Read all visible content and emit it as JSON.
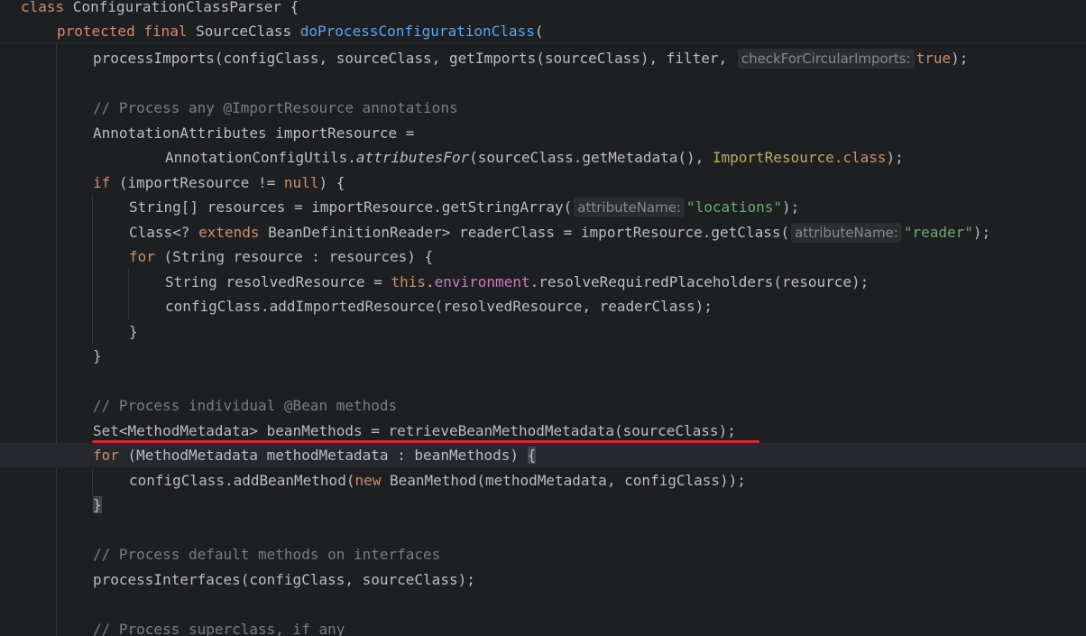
{
  "editor": {
    "lines": {
      "l0": {
        "kw": "class",
        "rest": " ConfigurationClassParser {"
      },
      "l1": {
        "kw1": "protected",
        "kw2": "final",
        "type": "SourceClass",
        "method": "doProcessConfigurationClass",
        "paren": "("
      },
      "l2": {
        "pre": "processImports(configClass, sourceClass, getImports(sourceClass), filter, ",
        "hint": "checkForCircularImports:",
        "val": "true",
        "post": ");"
      },
      "l3": {
        "comment": "// Process any @ImportResource annotations"
      },
      "l4": {
        "text": "AnnotationAttributes importResource ="
      },
      "l5": {
        "pre": "AnnotationConfigUtils.",
        "ital": "attributesFor",
        "mid": "(sourceClass.getMetadata(), ",
        "ann": "ImportResource",
        "dot": ".",
        "kw": "class",
        "post": ");"
      },
      "l6": {
        "kw": "if",
        "mid": " (importResource != ",
        "null": "null",
        "post": ") {"
      },
      "l7": {
        "pre": "String[] resources = importResource.getStringArray(",
        "hint": "attributeName:",
        "str": "\"locations\"",
        "post": ");"
      },
      "l8": {
        "pre": "Class<? ",
        "kw": "extends",
        "mid": " BeanDefinitionReader> readerClass = importResource.getClass(",
        "hint": "attributeName:",
        "str": "\"reader\"",
        "post": ");"
      },
      "l9": {
        "kw": "for",
        "post": " (String resource : resources) {"
      },
      "l10": {
        "pre": "String resolvedResource = ",
        "kw": "this",
        "dot": ".",
        "fld": "environment",
        "post": ".resolveRequiredPlaceholders(resource);"
      },
      "l11": {
        "text": "configClass.addImportedResource(resolvedResource, readerClass);"
      },
      "l12": {
        "text": "}"
      },
      "l13": {
        "text": "}"
      },
      "l14": {
        "comment": "// Process individual @Bean methods"
      },
      "l15": {
        "text": "Set<MethodMetadata> beanMethods = retrieveBeanMethodMetadata(sourceClass);"
      },
      "l16": {
        "kw": "for",
        "mid": " (MethodMetadata methodMetadata : beanMethods) ",
        "brace": "{"
      },
      "l17": {
        "pre": "configClass.addBeanMethod(",
        "kw": "new",
        "post": " BeanMethod(methodMetadata, configClass));"
      },
      "l18": {
        "brace": "}"
      },
      "l19": {
        "comment": "// Process default methods on interfaces"
      },
      "l20": {
        "text": "processInterfaces(configClass, sourceClass);"
      },
      "l21": {
        "comment": "// Process superclass, if any"
      }
    },
    "highlight_color": "#e0252a"
  }
}
